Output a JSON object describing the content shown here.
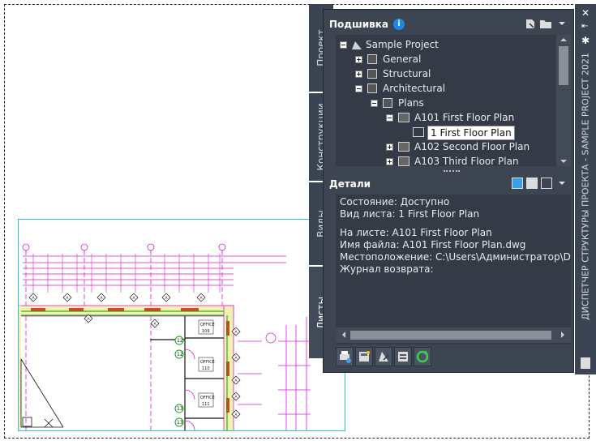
{
  "tabs": [
    {
      "label": "Проект"
    },
    {
      "label": "Конструкции"
    },
    {
      "label": "Виды"
    },
    {
      "label": "Листы"
    }
  ],
  "sheets_header": {
    "title": "Подшивка"
  },
  "tree": [
    {
      "label": "Sample Project"
    },
    {
      "label": "General"
    },
    {
      "label": "Structural"
    },
    {
      "label": "Architectural"
    },
    {
      "label": "Plans"
    },
    {
      "label": "A101 First Floor Plan"
    },
    {
      "label": "1 First Floor Plan"
    },
    {
      "label": "A102 Second Floor Plan"
    },
    {
      "label": "A103 Third Floor Plan"
    }
  ],
  "details_header": {
    "title": "Детали"
  },
  "details": [
    "Состояние: Доступно",
    "Вид листа: 1 First Floor Plan",
    "",
    "На листе: A101 First Floor Plan",
    "Имя файла: A101 First Floor Plan.dwg",
    "Местоположение: C:\\Users\\Администратор\\Documents",
    "Журнал возврата:"
  ],
  "palette_title": "ДИСПЕТЧЕР СТРУКТУРЫ ПРОЕКТА - SAMPLE PROJECT 2021",
  "drawing": {
    "office_labels": [
      "OFFICE",
      "OFFICE",
      "OFFICE"
    ],
    "office_numbers": [
      "109",
      "110",
      "111"
    ],
    "door_tags": [
      "12",
      "12",
      "13",
      "13"
    ],
    "wall_tags": [
      "A",
      "A",
      "A",
      "A",
      "A",
      "A",
      "A",
      "A",
      "A",
      "A",
      "A",
      "A",
      "A"
    ]
  },
  "colors": {
    "panel_bg": "#3d4452",
    "tree_bg": "#343b47",
    "tab_bg": "#3b4453",
    "selected_bg": "#ffffff",
    "drawing_frame": "#2bc0d8",
    "magenta": "#d21fd2",
    "green": "#00a000"
  }
}
